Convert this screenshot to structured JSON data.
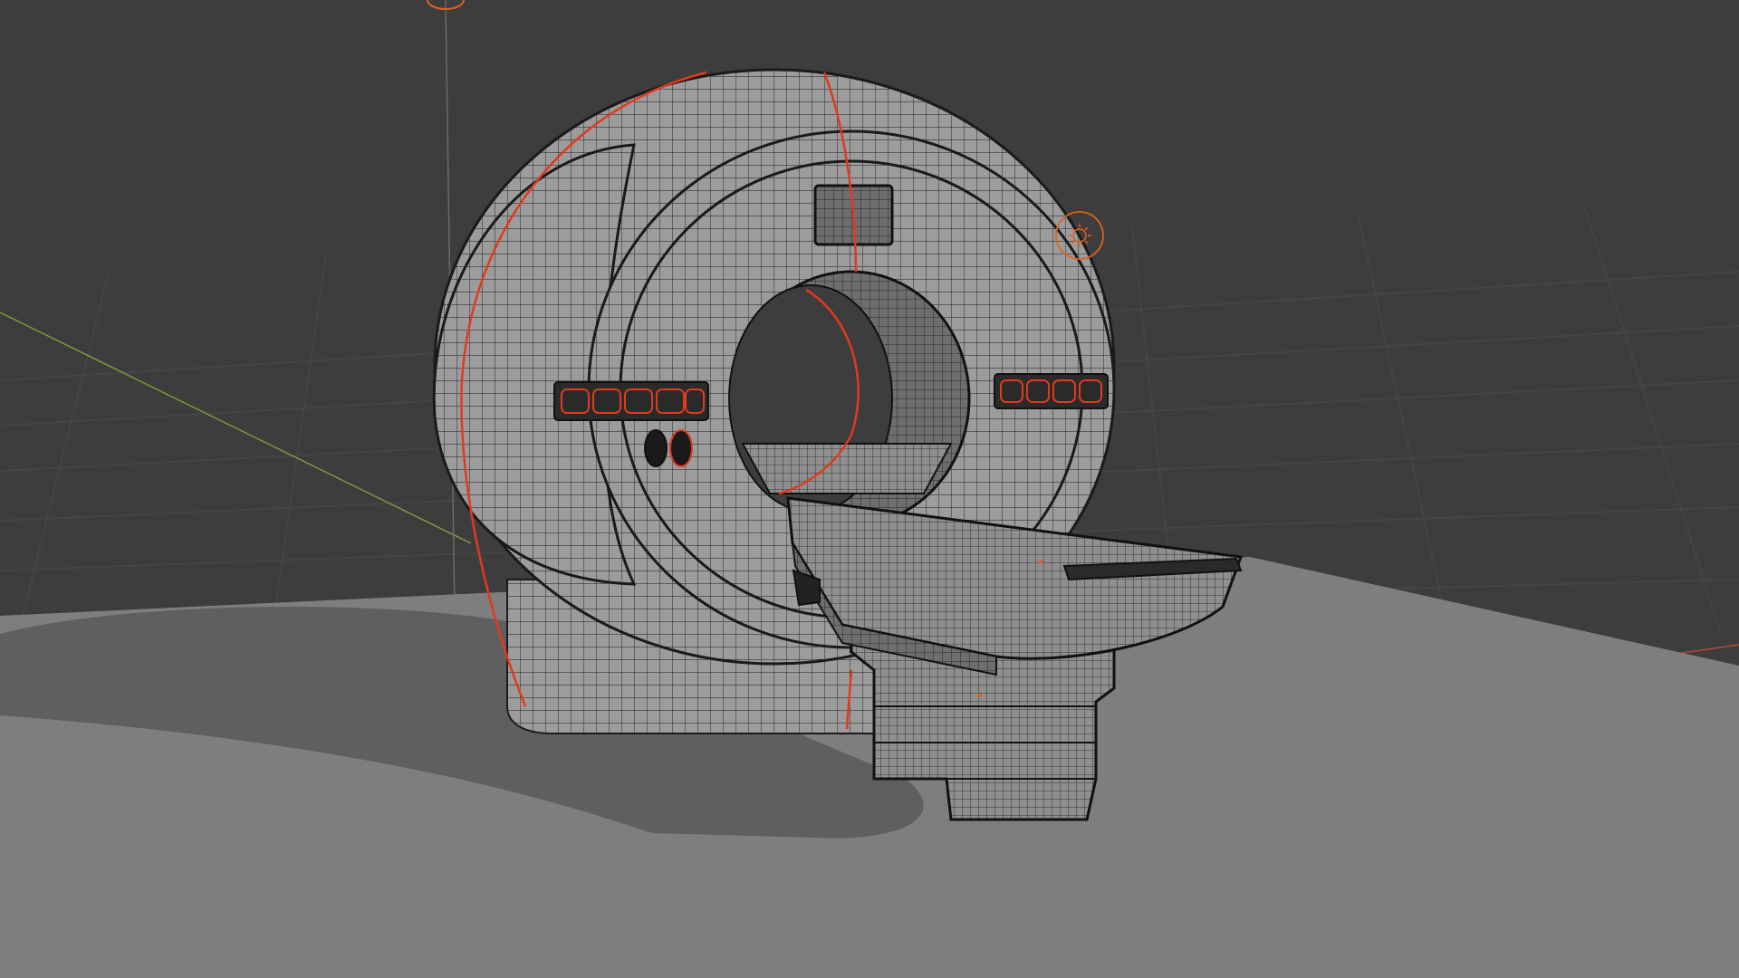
{
  "viewport": {
    "kind": "3d-viewport",
    "background_color": "#3d3d3d",
    "floor_color": "#7e7e7e",
    "grid_line_color": "#454545",
    "y_axis_color": "#7a9a3c",
    "x_axis_color": "#b04a3c",
    "shadow_color": "#5f5f5f"
  },
  "model": {
    "description_icon": "mri-scanner-wireframe",
    "mesh_color": "#9a9a9a",
    "wire_color": "#1c1c1c",
    "seam_color": "#e03a1e"
  },
  "objects": {
    "light": {
      "icon": "light-icon",
      "color": "#e0621e"
    },
    "camera_origin": {
      "icon": "origin-marker-icon",
      "color": "#e0621e"
    }
  }
}
